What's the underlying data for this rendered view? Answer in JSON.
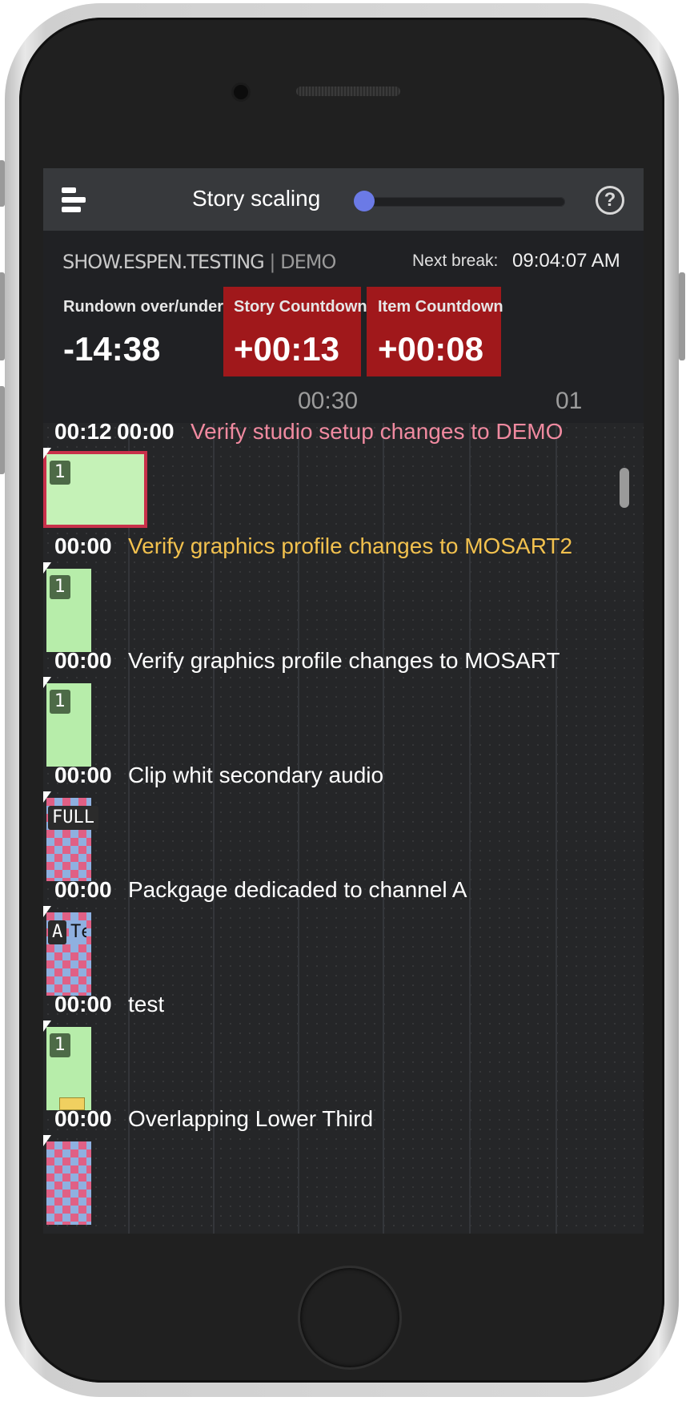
{
  "topbar": {
    "scaling_label": "Story scaling",
    "help_symbol": "?"
  },
  "header": {
    "show_name": "SHOW.ESPEN.TESTING",
    "separator": "|",
    "show_variant": "DEMO",
    "next_break_label": "Next break:",
    "next_break_value": "09:04:07 AM",
    "rundown_label": "Rundown over/under",
    "rundown_value": "-14:38",
    "story_countdown_label": "Story Countdown",
    "story_countdown_value": "+00:13",
    "item_countdown_label": "Item Countdown",
    "item_countdown_value": "+00:08",
    "alert_color": "#a0181b",
    "ticks": [
      "00:30",
      "01"
    ]
  },
  "stories": [
    {
      "elapsed": "00:12",
      "time": "00:00",
      "title": "Verify studio setup changes to DEMO",
      "title_color": "#f08aa0",
      "badge": "1",
      "kind": "green",
      "current": true
    },
    {
      "time": "00:00",
      "title": "Verify graphics profile changes to MOSART2",
      "title_color": "#f2c14e",
      "badge": "1",
      "kind": "green"
    },
    {
      "time": "00:00",
      "title": "Verify graphics profile changes to MOSART",
      "title_color": "#ffffff",
      "badge": "1",
      "kind": "green"
    },
    {
      "time": "00:00",
      "title": "Clip whit secondary audio",
      "title_color": "#ffffff",
      "badge": "FULL",
      "kind": "checker"
    },
    {
      "time": "00:00",
      "title": "Packgage dedicaded to channel A",
      "title_color": "#ffffff",
      "badge": "A",
      "badge2": "Te",
      "kind": "checker"
    },
    {
      "time": "00:00",
      "title": "test",
      "title_color": "#ffffff",
      "badge": "1",
      "kind": "green"
    },
    {
      "time": "00:00",
      "title": "Overlapping Lower Third",
      "title_color": "#ffffff",
      "kind": "checker"
    }
  ]
}
